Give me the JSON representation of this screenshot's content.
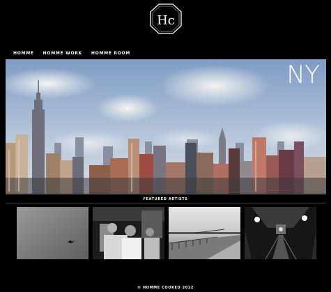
{
  "logo": {
    "text": "Hc",
    "icon": "hexagon-logo-icon"
  },
  "nav": {
    "items": [
      {
        "label": "HOMME"
      },
      {
        "label": "HOMME WORK"
      },
      {
        "label": "HOMME ROOM"
      }
    ]
  },
  "hero": {
    "label": "NY"
  },
  "featured": {
    "title": "FEATURED ARTISTS",
    "artists": [
      {
        "icon": "bird-sky-photo"
      },
      {
        "icon": "barber-shop-photo"
      },
      {
        "icon": "waterfront-pier-photo"
      },
      {
        "icon": "subway-tunnel-photo"
      }
    ]
  },
  "footer": {
    "copyright": "© HOMME COOKED 2012"
  }
}
